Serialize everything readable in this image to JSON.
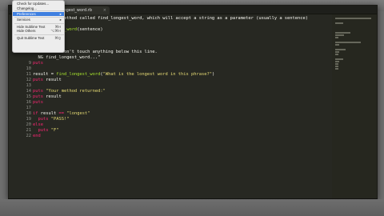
{
  "editor": {
    "tab_title": "longest_word.rb",
    "tab_close": "×"
  },
  "menu": {
    "items": [
      {
        "label": "Check for Updates...",
        "shortcut": ""
      },
      {
        "label": "Changelog...",
        "shortcut": ""
      },
      {
        "label": "Preferences",
        "shortcut": "",
        "submenu": true,
        "highlighted": true
      },
      {
        "label": "Services",
        "shortcut": "",
        "submenu": true
      },
      {
        "label": "Hide Sublime Text",
        "shortcut": "⌘H"
      },
      {
        "label": "Hide Others",
        "shortcut": "⌥⌘H"
      },
      {
        "label": "Quit Sublime Text",
        "shortcut": "⌘Q"
      }
    ],
    "arrow": "▸"
  },
  "code": {
    "lines": [
      {
        "n": "",
        "text": "       the method called find_longest_word, which will accept a string as a parameter (usually a sentence)"
      },
      {
        "n": "",
        "text": ""
      },
      {
        "n": "",
        "text": "     longest_word(sentence)"
      },
      {
        "n": "",
        "text": ""
      },
      {
        "n": "",
        "text": ""
      },
      {
        "n": "",
        "text": ""
      },
      {
        "n": "",
        "text": "     ode - don't touch anything below this line."
      },
      {
        "n": "",
        "text": "  NG find_longest_word...\""
      },
      {
        "n": "9",
        "text": "puts"
      },
      {
        "n": "10",
        "text": ""
      },
      {
        "n": "11",
        "text": "result = find_longest_word(\"What is the longest word in this phrase?\")"
      },
      {
        "n": "12",
        "text": "puts result"
      },
      {
        "n": "13",
        "text": ""
      },
      {
        "n": "14",
        "text": "puts \"Your method returned:\""
      },
      {
        "n": "15",
        "text": "puts result"
      },
      {
        "n": "16",
        "text": "puts"
      },
      {
        "n": "17",
        "text": ""
      },
      {
        "n": "18",
        "text": "if result == \"longest\""
      },
      {
        "n": "19",
        "text": "  puts \"PASS!\""
      },
      {
        "n": "20",
        "text": "else"
      },
      {
        "n": "21",
        "text": "  puts \"F\""
      },
      {
        "n": "22",
        "text": "end"
      }
    ]
  }
}
